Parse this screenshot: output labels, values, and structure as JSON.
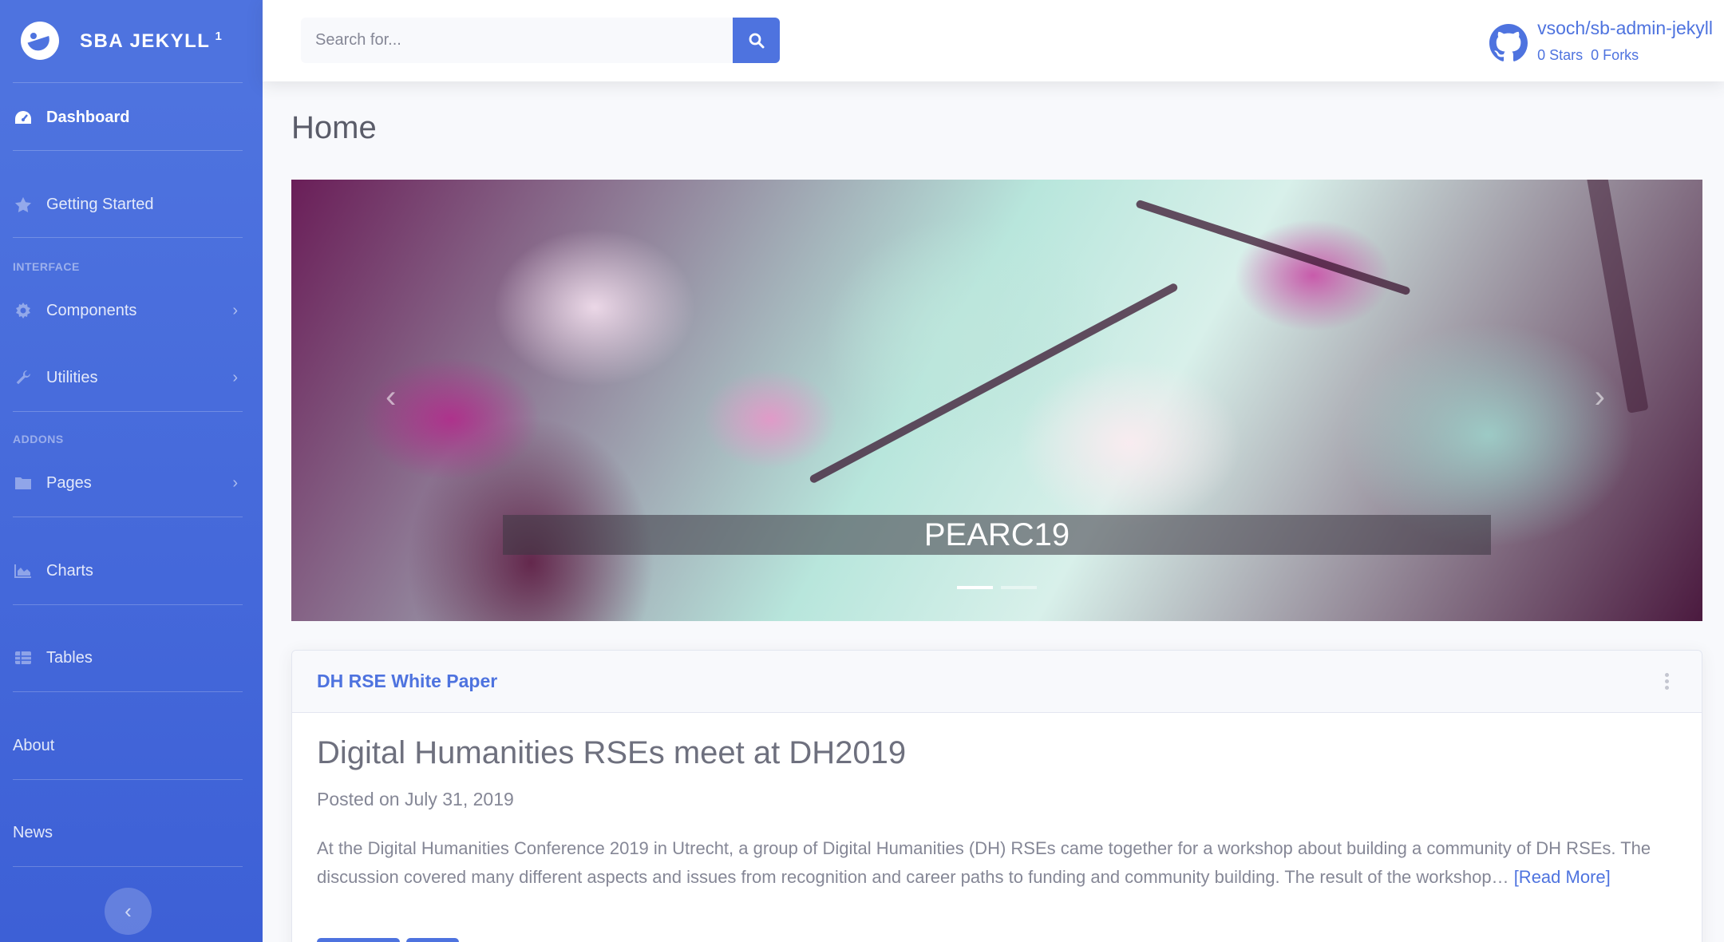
{
  "brand": {
    "name": "SBA JEKYLL",
    "sup": "1"
  },
  "sidebar": {
    "dashboard": "Dashboard",
    "getting_started": "Getting Started",
    "heading_interface": "INTERFACE",
    "components": "Components",
    "utilities": "Utilities",
    "heading_addons": "ADDONS",
    "pages": "Pages",
    "charts": "Charts",
    "tables": "Tables",
    "about": "About",
    "news": "News"
  },
  "search": {
    "placeholder": "Search for..."
  },
  "repo": {
    "name": "vsoch/sb-admin-jekyll",
    "stars": "0 Stars",
    "forks": "0 Forks"
  },
  "page": {
    "title": "Home"
  },
  "carousel": {
    "caption": "PEARC19",
    "slides": 2,
    "active_slide": 1
  },
  "card": {
    "header": "DH RSE White Paper",
    "post_title": "Digital Humanities RSEs meet at DH2019",
    "post_date": "Posted on July 31, 2019",
    "post_excerpt": "At the Digital Humanities Conference 2019 in Utrecht, a group of Digital Humanities (DH) RSEs came together for a workshop about building a community of DH RSEs. The discussion covered many different aspects and issues from recognition and career paths to funding and community building. The result of the workshop…",
    "read_more": "[Read More]"
  },
  "colors": {
    "primary": "#4e73df",
    "background": "#f8f9fc",
    "text": "#858796"
  }
}
